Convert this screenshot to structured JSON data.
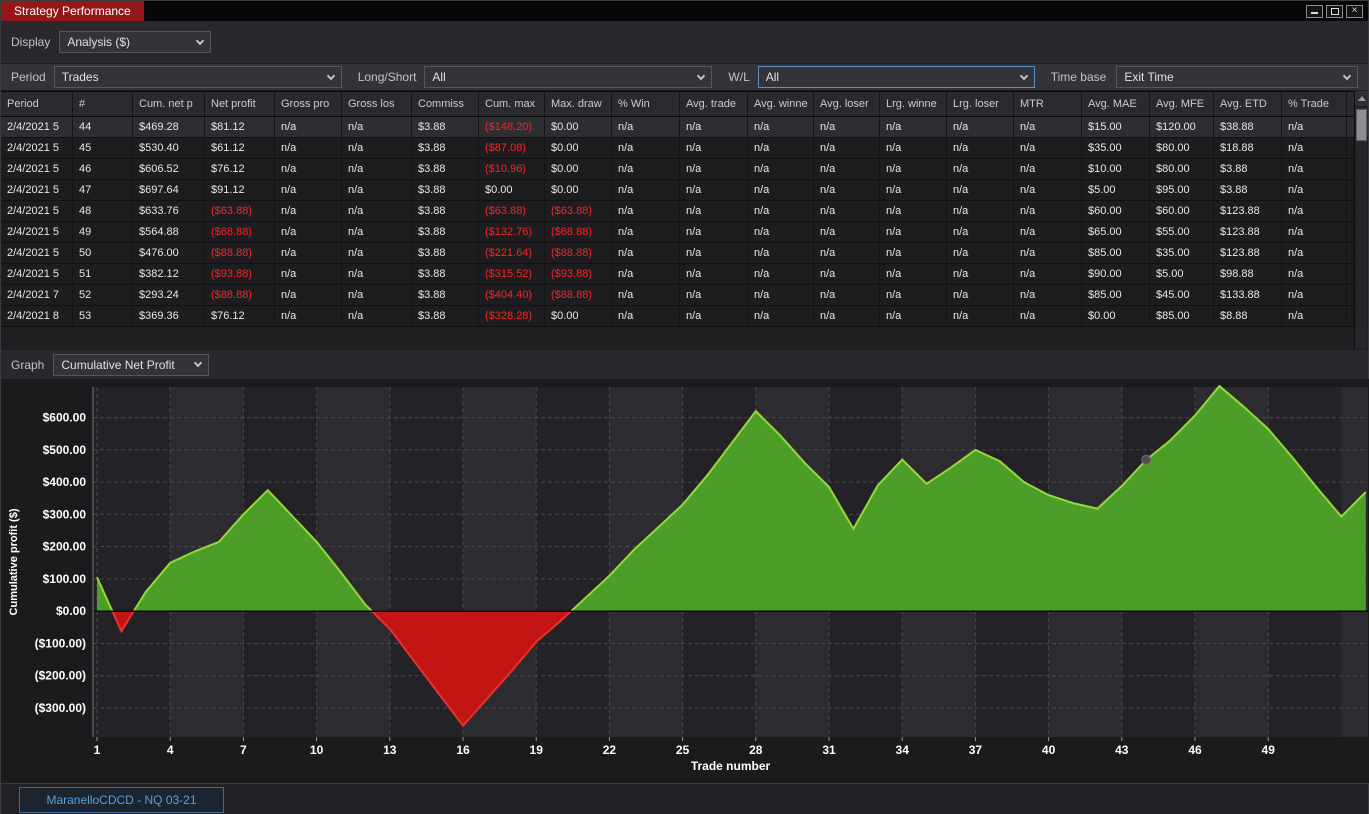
{
  "window": {
    "title": "Strategy Performance"
  },
  "toolbar": {
    "display_label": "Display",
    "display_value": "Analysis ($)",
    "period_label": "Period",
    "period_value": "Trades",
    "longshort_label": "Long/Short",
    "longshort_value": "All",
    "wl_label": "W/L",
    "wl_value": "All",
    "timebase_label": "Time base",
    "timebase_value": "Exit Time"
  },
  "table": {
    "columns": [
      "Period",
      "#",
      "Cum. net p",
      "Net profit",
      "Gross pro",
      "Gross los",
      "Commiss",
      "Cum. max",
      "Max. draw",
      "% Win",
      "Avg. trade",
      "Avg. winne",
      "Avg. loser",
      "Lrg. winne",
      "Lrg. loser",
      "MTR",
      "Avg. MAE",
      "Avg. MFE",
      "Avg. ETD",
      "% Trade"
    ],
    "selected_row": 0,
    "rows": [
      [
        "2/4/2021 5",
        "44",
        "$469.28",
        "$81.12",
        "n/a",
        "n/a",
        "$3.88",
        "($148.20)",
        "$0.00",
        "n/a",
        "n/a",
        "n/a",
        "n/a",
        "n/a",
        "n/a",
        "n/a",
        "$15.00",
        "$120.00",
        "$38.88",
        "n/a"
      ],
      [
        "2/4/2021 5",
        "45",
        "$530.40",
        "$61.12",
        "n/a",
        "n/a",
        "$3.88",
        "($87.08)",
        "$0.00",
        "n/a",
        "n/a",
        "n/a",
        "n/a",
        "n/a",
        "n/a",
        "n/a",
        "$35.00",
        "$80.00",
        "$18.88",
        "n/a"
      ],
      [
        "2/4/2021 5",
        "46",
        "$606.52",
        "$76.12",
        "n/a",
        "n/a",
        "$3.88",
        "($10.96)",
        "$0.00",
        "n/a",
        "n/a",
        "n/a",
        "n/a",
        "n/a",
        "n/a",
        "n/a",
        "$10.00",
        "$80.00",
        "$3.88",
        "n/a"
      ],
      [
        "2/4/2021 5",
        "47",
        "$697.64",
        "$91.12",
        "n/a",
        "n/a",
        "$3.88",
        "$0.00",
        "$0.00",
        "n/a",
        "n/a",
        "n/a",
        "n/a",
        "n/a",
        "n/a",
        "n/a",
        "$5.00",
        "$95.00",
        "$3.88",
        "n/a"
      ],
      [
        "2/4/2021 5",
        "48",
        "$633.76",
        "($63.88)",
        "n/a",
        "n/a",
        "$3.88",
        "($63.88)",
        "($63.88)",
        "n/a",
        "n/a",
        "n/a",
        "n/a",
        "n/a",
        "n/a",
        "n/a",
        "$60.00",
        "$60.00",
        "$123.88",
        "n/a"
      ],
      [
        "2/4/2021 5",
        "49",
        "$564.88",
        "($68.88)",
        "n/a",
        "n/a",
        "$3.88",
        "($132.76)",
        "($68.88)",
        "n/a",
        "n/a",
        "n/a",
        "n/a",
        "n/a",
        "n/a",
        "n/a",
        "$65.00",
        "$55.00",
        "$123.88",
        "n/a"
      ],
      [
        "2/4/2021 5",
        "50",
        "$476.00",
        "($88.88)",
        "n/a",
        "n/a",
        "$3.88",
        "($221.64)",
        "($88.88)",
        "n/a",
        "n/a",
        "n/a",
        "n/a",
        "n/a",
        "n/a",
        "n/a",
        "$85.00",
        "$35.00",
        "$123.88",
        "n/a"
      ],
      [
        "2/4/2021 5",
        "51",
        "$382.12",
        "($93.88)",
        "n/a",
        "n/a",
        "$3.88",
        "($315.52)",
        "($93.88)",
        "n/a",
        "n/a",
        "n/a",
        "n/a",
        "n/a",
        "n/a",
        "n/a",
        "$90.00",
        "$5.00",
        "$98.88",
        "n/a"
      ],
      [
        "2/4/2021 7",
        "52",
        "$293.24",
        "($88.88)",
        "n/a",
        "n/a",
        "$3.88",
        "($404.40)",
        "($88.88)",
        "n/a",
        "n/a",
        "n/a",
        "n/a",
        "n/a",
        "n/a",
        "n/a",
        "$85.00",
        "$45.00",
        "$133.88",
        "n/a"
      ],
      [
        "2/4/2021 8",
        "53",
        "$369.36",
        "$76.12",
        "n/a",
        "n/a",
        "$3.88",
        "($328.28)",
        "$0.00",
        "n/a",
        "n/a",
        "n/a",
        "n/a",
        "n/a",
        "n/a",
        "n/a",
        "$0.00",
        "$85.00",
        "$8.88",
        "n/a"
      ]
    ]
  },
  "graph": {
    "label": "Graph",
    "selector_value": "Cumulative Net Profit"
  },
  "chart_data": {
    "type": "area",
    "title": "Cumulative Net Profit",
    "xlabel": "Trade number",
    "ylabel": "Cumulative profit ($)",
    "x": [
      1,
      2,
      3,
      4,
      5,
      6,
      7,
      8,
      9,
      10,
      11,
      12,
      13,
      14,
      15,
      16,
      17,
      18,
      19,
      20,
      21,
      22,
      23,
      24,
      25,
      26,
      27,
      28,
      29,
      30,
      31,
      32,
      33,
      34,
      35,
      36,
      37,
      38,
      39,
      40,
      41,
      42,
      43,
      44,
      45,
      46,
      47,
      48,
      49,
      50,
      51,
      52,
      53
    ],
    "values": [
      105,
      -62,
      60,
      150,
      185,
      215,
      300,
      375,
      295,
      215,
      120,
      20,
      -55,
      -155,
      -255,
      -355,
      -270,
      -185,
      -95,
      -30,
      40,
      110,
      190,
      260,
      330,
      420,
      520,
      620,
      545,
      460,
      385,
      255,
      390,
      470,
      395,
      445,
      500,
      465,
      400,
      360,
      335,
      318,
      388,
      469.28,
      530.4,
      606.52,
      697.64,
      633.76,
      564.88,
      476.0,
      382.12,
      293.24,
      369.36
    ],
    "xticks": [
      1,
      4,
      7,
      10,
      13,
      16,
      19,
      22,
      25,
      28,
      31,
      34,
      37,
      40,
      43,
      46,
      49
    ],
    "yticks": [
      {
        "value": 600,
        "label": "$600.00"
      },
      {
        "value": 500,
        "label": "$500.00"
      },
      {
        "value": 400,
        "label": "$400.00"
      },
      {
        "value": 300,
        "label": "$300.00"
      },
      {
        "value": 200,
        "label": "$200.00"
      },
      {
        "value": 100,
        "label": "$100.00"
      },
      {
        "value": 0,
        "label": "$0.00"
      },
      {
        "value": -100,
        "label": "($100.00)"
      },
      {
        "value": -200,
        "label": "($200.00)"
      },
      {
        "value": -300,
        "label": "($300.00)"
      }
    ],
    "ylim": [
      -390,
      695
    ],
    "marker": {
      "x": 44,
      "y": 469.28
    },
    "positive_fill": "#4c9e28",
    "positive_line": "#96d83a",
    "negative_fill": "#c41515",
    "negative_line": "#e63232",
    "grid": true,
    "legend_position": "none"
  },
  "footer": {
    "tab": "MaranelloCDCD - NQ 03-21"
  }
}
